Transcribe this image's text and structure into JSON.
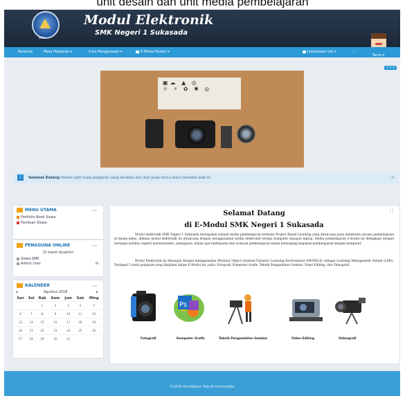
{
  "caption": "unit desain dan unit media pembelajaran",
  "header": {
    "logo_label": "BALI",
    "title": "Modul Elektronik",
    "subtitle": "SMK Negeri 1 Sukasada",
    "avatar_label": "Tamu"
  },
  "nav": {
    "items": [
      "Beranda",
      "Mata Pelajaran",
      "Cara Penggunaan",
      "E-Modul Ekskul"
    ],
    "language": "Indonesian (id)",
    "dots": "• • •"
  },
  "alert": {
    "strong": "Selamat Datang",
    "text": "Silakan pilih mata pelajaran yang tersedia dan ikuti pada menu-menu tersedia web ini"
  },
  "blocks": {
    "menu": {
      "title": "MENU UTAMA",
      "items": [
        "Portfolio Book Siswa",
        "Panduan Siswa"
      ]
    },
    "online": {
      "title": "PENGGUNA ONLINE",
      "note": "(5 menit terakhir)",
      "users": [
        "Siswa SMK",
        "Admin User"
      ]
    },
    "calendar": {
      "title": "KALENDER",
      "month": "Agustus 2018",
      "days": [
        "Sen",
        "Sel",
        "Rab",
        "Kam",
        "Jum",
        "Sab",
        "Ming"
      ],
      "weeks": [
        [
          "",
          "",
          "1",
          "2",
          "3",
          "4",
          "5"
        ],
        [
          "6",
          "7",
          "8",
          "9",
          "10",
          "11",
          "12"
        ],
        [
          "13",
          "14",
          "15",
          "16",
          "17",
          "18",
          "19"
        ],
        [
          "20",
          "21",
          "22",
          "23",
          "24",
          "25",
          "26"
        ],
        [
          "27",
          "28",
          "29",
          "30",
          "31",
          "",
          ""
        ]
      ]
    }
  },
  "main": {
    "heading": "Selamat Datang",
    "subheading": "di E-Modul SMK Negeri 1 Sukasada",
    "para1": "Modul elektronik SMK Negeri 1 Sukasada merupakan sebuah media pembelajaran berbasis Project Based Learning yang dirancang guna membantu proses pembelajaran di dalam kelas, dimana modul elektronik ini dirancang dengan menggunakan media elektronik berupa komputer maupun laptop. Media pembelajaran e-modul ini dilengkapi dengan berbagai fasilitas seperti konten/materi, penugasan, bahan ajar multimedia dan evaluasi pembelajaran dalam menunjang kegiatan pembelajaran dengan komputer.",
    "para2": "Modul Elektronik ini dibangun dengan menggunakan Modular Object oriented Dynamic Learning Environment (MOODLE) sebagai Learning Management Sistem (LMS). Terdapat 5 mata pelajaran yang disajikan dalam E-Modul ini, yaitu: Fotografi, Komputer Grafis, Teknik Pengambilan Gambar, Video Editing, dan Videografi.",
    "courses": [
      "Fotografi",
      "Komputer Grafis",
      "Teknik Pengambilan Gambar",
      "Video Editing",
      "Videografi"
    ]
  },
  "footer": {
    "text": "©2018 Pendidikan Teknik Informatika"
  },
  "colors": {
    "header_bg": "#1f2d3f",
    "nav_bg": "#2b9ad6",
    "alert_bg": "#d9ebf6",
    "block_title": "#1a6fb0",
    "footer_bg": "#3a9fd6"
  }
}
